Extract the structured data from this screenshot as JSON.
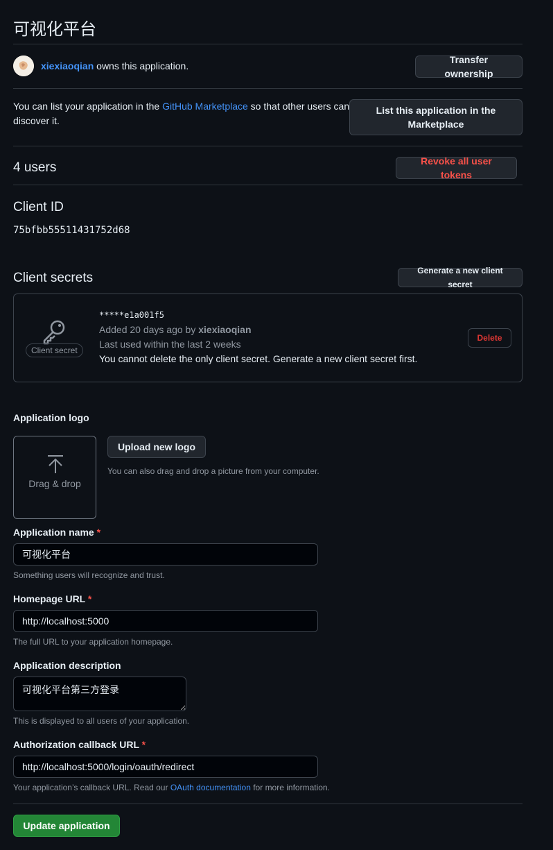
{
  "page": {
    "title": "可视化平台"
  },
  "owner": {
    "username": "xiexiaoqian",
    "suffix": "owns this application.",
    "transfer_label": "Transfer ownership"
  },
  "marketplace": {
    "text_before": "You can list your application in the ",
    "link": "GitHub Marketplace",
    "text_after": " so that other users can discover it.",
    "button_line1": "List this application in the",
    "button_line2": "Marketplace"
  },
  "users": {
    "count": "4",
    "label": "users",
    "revoke_label": "Revoke all user tokens"
  },
  "client_id": {
    "heading": "Client ID",
    "value": "75bfbb55511431752d68"
  },
  "client_secrets": {
    "heading": "Client secrets",
    "generate_label": "Generate a new client secret",
    "badge": "Client secret",
    "masked": "*****e1a001f5",
    "added_prefix": "Added 20 days ago by ",
    "added_by": "xiexiaoqian",
    "last_used": "Last used within the last 2 weeks",
    "warning": "You cannot delete the only client secret. Generate a new client secret first.",
    "delete_label": "Delete"
  },
  "logo": {
    "label": "Application logo",
    "drag_text": "Drag & drop",
    "upload_label": "Upload new logo",
    "hint": "You can also drag and drop a picture from your computer."
  },
  "form": {
    "required_mark": "*",
    "name": {
      "label": "Application name",
      "value": "可视化平台",
      "hint": "Something users will recognize and trust."
    },
    "homepage": {
      "label": "Homepage URL",
      "value": "http://localhost:5000",
      "hint": "The full URL to your application homepage."
    },
    "description": {
      "label": "Application description",
      "value": "可视化平台第三方登录",
      "hint": "This is displayed to all users of your application."
    },
    "callback": {
      "label": "Authorization callback URL",
      "value": "http://localhost:5000/login/oauth/redirect",
      "hint_before": "Your application’s callback URL. Read our ",
      "hint_link": "OAuth documentation",
      "hint_after": " for more information."
    },
    "update_label": "Update application"
  },
  "colors": {
    "background": "#0d1117",
    "link": "#4493f8",
    "danger": "#f85149",
    "primary": "#238636"
  }
}
